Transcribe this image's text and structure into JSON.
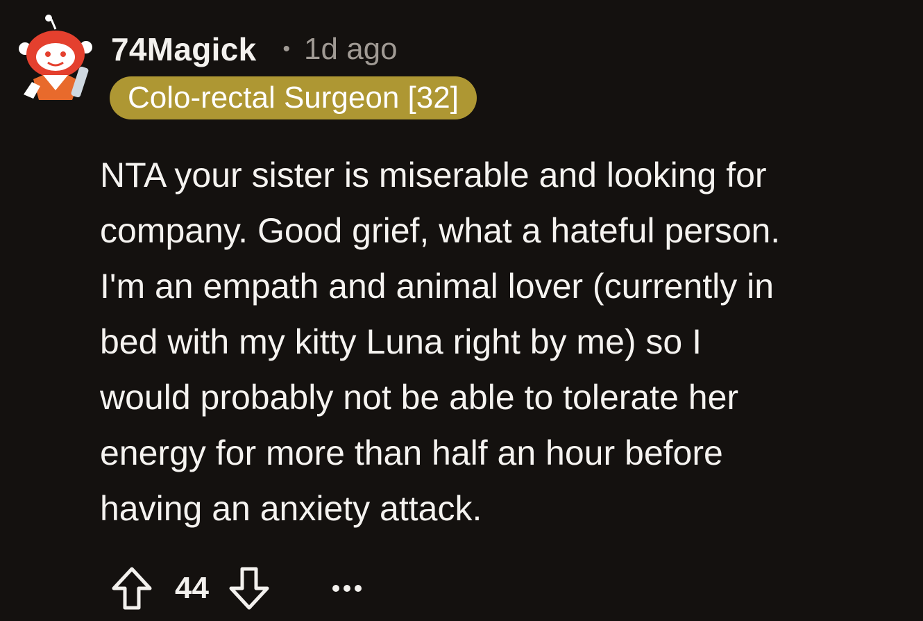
{
  "comment": {
    "author": "74Magick",
    "separator": "•",
    "time_ago": "1d ago",
    "flair": "Colo-rectal Surgeon [32]",
    "body": "NTA your sister is miserable and looking for\ncompany. Good grief, what a hateful person.\nI'm an empath and animal lover (currently in\nbed with my kitty Luna right by me) so I\nwould probably not be able to tolerate her\nenergy for more than half an hour before\nhaving an anxiety attack.",
    "score": "44"
  },
  "icons": {
    "avatar": "reddit-snoo-avatar-icon",
    "upvote": "arrow-up-icon",
    "downvote": "arrow-down-icon",
    "more": "more-horizontal-icon"
  },
  "colors": {
    "background": "#14110f",
    "flair_background": "#ae9733",
    "meta_text": "#a09a94",
    "text": "#f5f3f0"
  }
}
